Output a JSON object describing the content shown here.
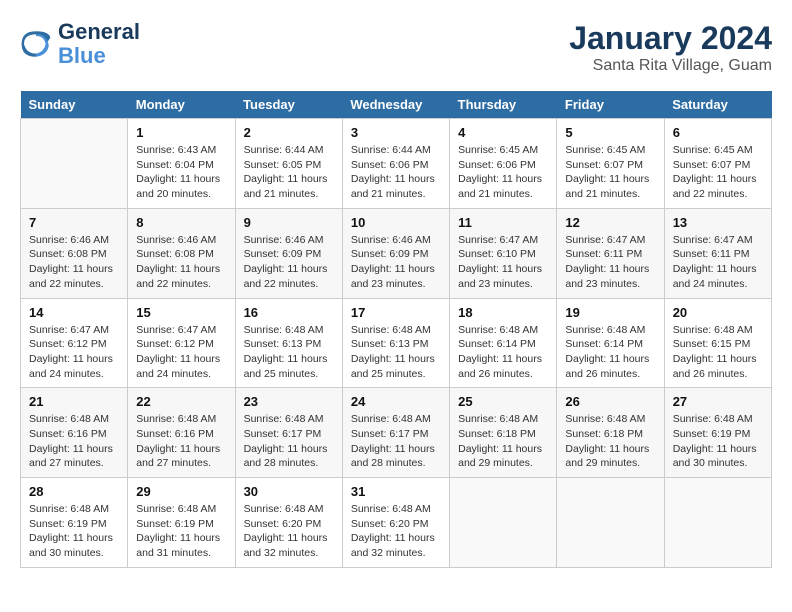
{
  "logo": {
    "text_general": "General",
    "text_blue": "Blue"
  },
  "title": "January 2024",
  "subtitle": "Santa Rita Village, Guam",
  "days_of_week": [
    "Sunday",
    "Monday",
    "Tuesday",
    "Wednesday",
    "Thursday",
    "Friday",
    "Saturday"
  ],
  "weeks": [
    [
      {
        "day": "",
        "info": ""
      },
      {
        "day": "1",
        "info": "Sunrise: 6:43 AM\nSunset: 6:04 PM\nDaylight: 11 hours\nand 20 minutes."
      },
      {
        "day": "2",
        "info": "Sunrise: 6:44 AM\nSunset: 6:05 PM\nDaylight: 11 hours\nand 21 minutes."
      },
      {
        "day": "3",
        "info": "Sunrise: 6:44 AM\nSunset: 6:06 PM\nDaylight: 11 hours\nand 21 minutes."
      },
      {
        "day": "4",
        "info": "Sunrise: 6:45 AM\nSunset: 6:06 PM\nDaylight: 11 hours\nand 21 minutes."
      },
      {
        "day": "5",
        "info": "Sunrise: 6:45 AM\nSunset: 6:07 PM\nDaylight: 11 hours\nand 21 minutes."
      },
      {
        "day": "6",
        "info": "Sunrise: 6:45 AM\nSunset: 6:07 PM\nDaylight: 11 hours\nand 22 minutes."
      }
    ],
    [
      {
        "day": "7",
        "info": "Sunrise: 6:46 AM\nSunset: 6:08 PM\nDaylight: 11 hours\nand 22 minutes."
      },
      {
        "day": "8",
        "info": "Sunrise: 6:46 AM\nSunset: 6:08 PM\nDaylight: 11 hours\nand 22 minutes."
      },
      {
        "day": "9",
        "info": "Sunrise: 6:46 AM\nSunset: 6:09 PM\nDaylight: 11 hours\nand 22 minutes."
      },
      {
        "day": "10",
        "info": "Sunrise: 6:46 AM\nSunset: 6:09 PM\nDaylight: 11 hours\nand 23 minutes."
      },
      {
        "day": "11",
        "info": "Sunrise: 6:47 AM\nSunset: 6:10 PM\nDaylight: 11 hours\nand 23 minutes."
      },
      {
        "day": "12",
        "info": "Sunrise: 6:47 AM\nSunset: 6:11 PM\nDaylight: 11 hours\nand 23 minutes."
      },
      {
        "day": "13",
        "info": "Sunrise: 6:47 AM\nSunset: 6:11 PM\nDaylight: 11 hours\nand 24 minutes."
      }
    ],
    [
      {
        "day": "14",
        "info": "Sunrise: 6:47 AM\nSunset: 6:12 PM\nDaylight: 11 hours\nand 24 minutes."
      },
      {
        "day": "15",
        "info": "Sunrise: 6:47 AM\nSunset: 6:12 PM\nDaylight: 11 hours\nand 24 minutes."
      },
      {
        "day": "16",
        "info": "Sunrise: 6:48 AM\nSunset: 6:13 PM\nDaylight: 11 hours\nand 25 minutes."
      },
      {
        "day": "17",
        "info": "Sunrise: 6:48 AM\nSunset: 6:13 PM\nDaylight: 11 hours\nand 25 minutes."
      },
      {
        "day": "18",
        "info": "Sunrise: 6:48 AM\nSunset: 6:14 PM\nDaylight: 11 hours\nand 26 minutes."
      },
      {
        "day": "19",
        "info": "Sunrise: 6:48 AM\nSunset: 6:14 PM\nDaylight: 11 hours\nand 26 minutes."
      },
      {
        "day": "20",
        "info": "Sunrise: 6:48 AM\nSunset: 6:15 PM\nDaylight: 11 hours\nand 26 minutes."
      }
    ],
    [
      {
        "day": "21",
        "info": "Sunrise: 6:48 AM\nSunset: 6:16 PM\nDaylight: 11 hours\nand 27 minutes."
      },
      {
        "day": "22",
        "info": "Sunrise: 6:48 AM\nSunset: 6:16 PM\nDaylight: 11 hours\nand 27 minutes."
      },
      {
        "day": "23",
        "info": "Sunrise: 6:48 AM\nSunset: 6:17 PM\nDaylight: 11 hours\nand 28 minutes."
      },
      {
        "day": "24",
        "info": "Sunrise: 6:48 AM\nSunset: 6:17 PM\nDaylight: 11 hours\nand 28 minutes."
      },
      {
        "day": "25",
        "info": "Sunrise: 6:48 AM\nSunset: 6:18 PM\nDaylight: 11 hours\nand 29 minutes."
      },
      {
        "day": "26",
        "info": "Sunrise: 6:48 AM\nSunset: 6:18 PM\nDaylight: 11 hours\nand 29 minutes."
      },
      {
        "day": "27",
        "info": "Sunrise: 6:48 AM\nSunset: 6:19 PM\nDaylight: 11 hours\nand 30 minutes."
      }
    ],
    [
      {
        "day": "28",
        "info": "Sunrise: 6:48 AM\nSunset: 6:19 PM\nDaylight: 11 hours\nand 30 minutes."
      },
      {
        "day": "29",
        "info": "Sunrise: 6:48 AM\nSunset: 6:19 PM\nDaylight: 11 hours\nand 31 minutes."
      },
      {
        "day": "30",
        "info": "Sunrise: 6:48 AM\nSunset: 6:20 PM\nDaylight: 11 hours\nand 32 minutes."
      },
      {
        "day": "31",
        "info": "Sunrise: 6:48 AM\nSunset: 6:20 PM\nDaylight: 11 hours\nand 32 minutes."
      },
      {
        "day": "",
        "info": ""
      },
      {
        "day": "",
        "info": ""
      },
      {
        "day": "",
        "info": ""
      }
    ]
  ]
}
